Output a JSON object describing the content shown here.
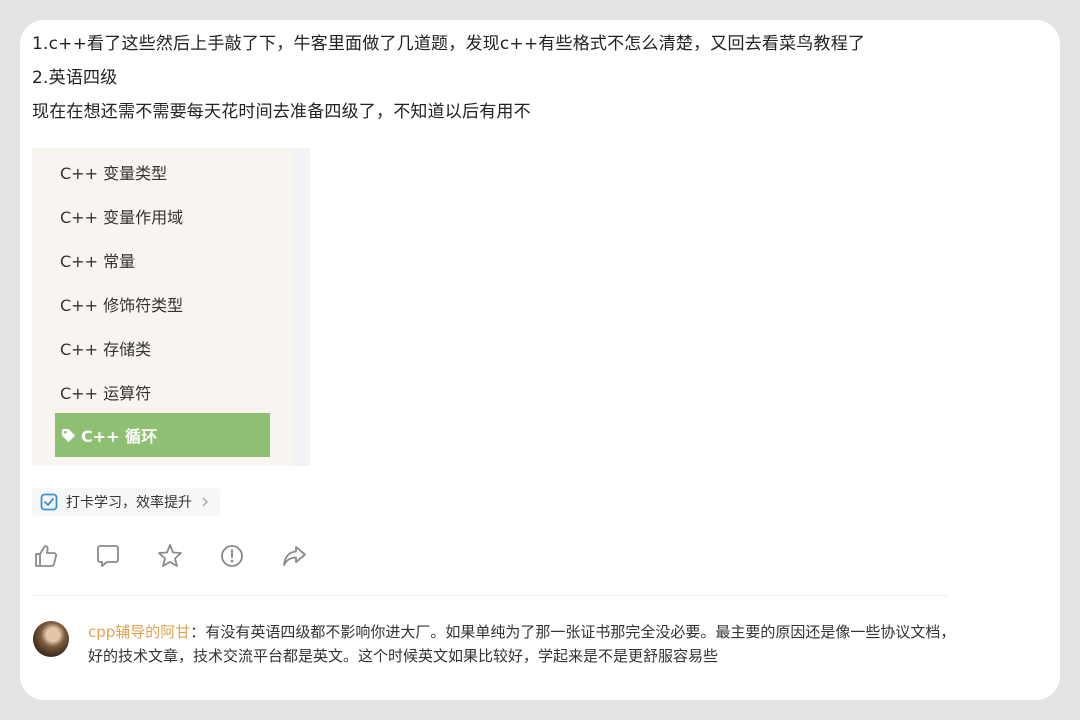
{
  "post": {
    "line1": "1.c++看了这些然后上手敲了下，牛客里面做了几道题，发现c++有些格式不怎么清楚，又回去看菜鸟教程了",
    "line2": "2.英语四级",
    "line3": "现在在想还需不需要每天花时间去准备四级了，不知道以后有用不"
  },
  "menu": {
    "items": [
      "C++ 变量类型",
      "C++ 变量作用域",
      "C++ 常量",
      "C++ 修饰符类型",
      "C++ 存储类",
      "C++ 运算符"
    ],
    "active": "C++ 循环",
    "active_color": "#8fbf72"
  },
  "topic": {
    "label": "打卡学习，效率提升",
    "icon": "checkbox-icon"
  },
  "actions": [
    "like-icon",
    "comment-icon",
    "star-icon",
    "report-icon",
    "share-icon"
  ],
  "comment": {
    "author": "cpp辅导的阿甘",
    "separator": "：",
    "text": "有没有英语四级都不影响你进大厂。如果单纯为了那一张证书那完全没必要。最主要的原因还是像一些协议文档，好的技术文章，技术交流平台都是英文。这个时候英文如果比较好，学起来是不是更舒服容易些",
    "author_color": "#e1a24f"
  }
}
